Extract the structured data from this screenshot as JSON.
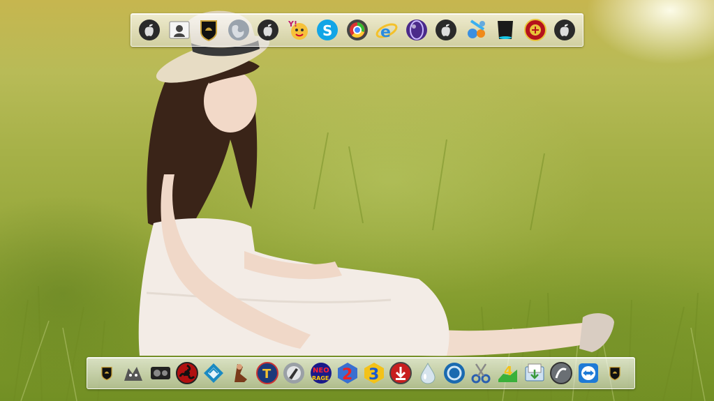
{
  "desktop": {
    "wallpaper": "girl-in-hat-sitting-in-grass",
    "colors": {
      "grass": "#97a83c",
      "dress": "#f3ece6",
      "hair": "#3a2418",
      "hat": "#e7dcc4",
      "hat_band": "#3a3a3a"
    }
  },
  "top_dock": {
    "items": [
      {
        "icon": "apple-icon"
      },
      {
        "icon": "contacts-icon"
      },
      {
        "icon": "lamborghini-icon"
      },
      {
        "icon": "globe-icon"
      },
      {
        "icon": "apple-icon"
      },
      {
        "icon": "yahoo-messenger-icon"
      },
      {
        "icon": "skype-icon"
      },
      {
        "icon": "browser-icon"
      },
      {
        "icon": "internet-explorer-icon"
      },
      {
        "icon": "purple-orb-icon"
      },
      {
        "icon": "apple-icon"
      },
      {
        "icon": "system-tools-icon"
      },
      {
        "icon": "trash-icon"
      },
      {
        "icon": "manchester-united-icon"
      },
      {
        "icon": "apple-icon"
      }
    ]
  },
  "bottom_dock": {
    "items": [
      {
        "icon": "lamborghini-icon"
      },
      {
        "icon": "cat-game-icon"
      },
      {
        "icon": "gears-icon"
      },
      {
        "icon": "sharingan-icon"
      },
      {
        "icon": "emblem-icon"
      },
      {
        "icon": "fighter-game-icon"
      },
      {
        "icon": "tekken-icon"
      },
      {
        "icon": "counter-strike-icon"
      },
      {
        "icon": "neo-ragex-icon"
      },
      {
        "icon": "game-2-icon"
      },
      {
        "icon": "game-3-icon"
      },
      {
        "icon": "download-icon"
      },
      {
        "icon": "water-drop-icon"
      },
      {
        "icon": "refresh-ring-icon"
      },
      {
        "icon": "scissors-icon"
      },
      {
        "icon": "game-4-icon"
      },
      {
        "icon": "install-box-icon"
      },
      {
        "icon": "grey-orb-icon"
      },
      {
        "icon": "teamviewer-icon"
      },
      {
        "icon": "lamborghini-icon"
      }
    ]
  }
}
